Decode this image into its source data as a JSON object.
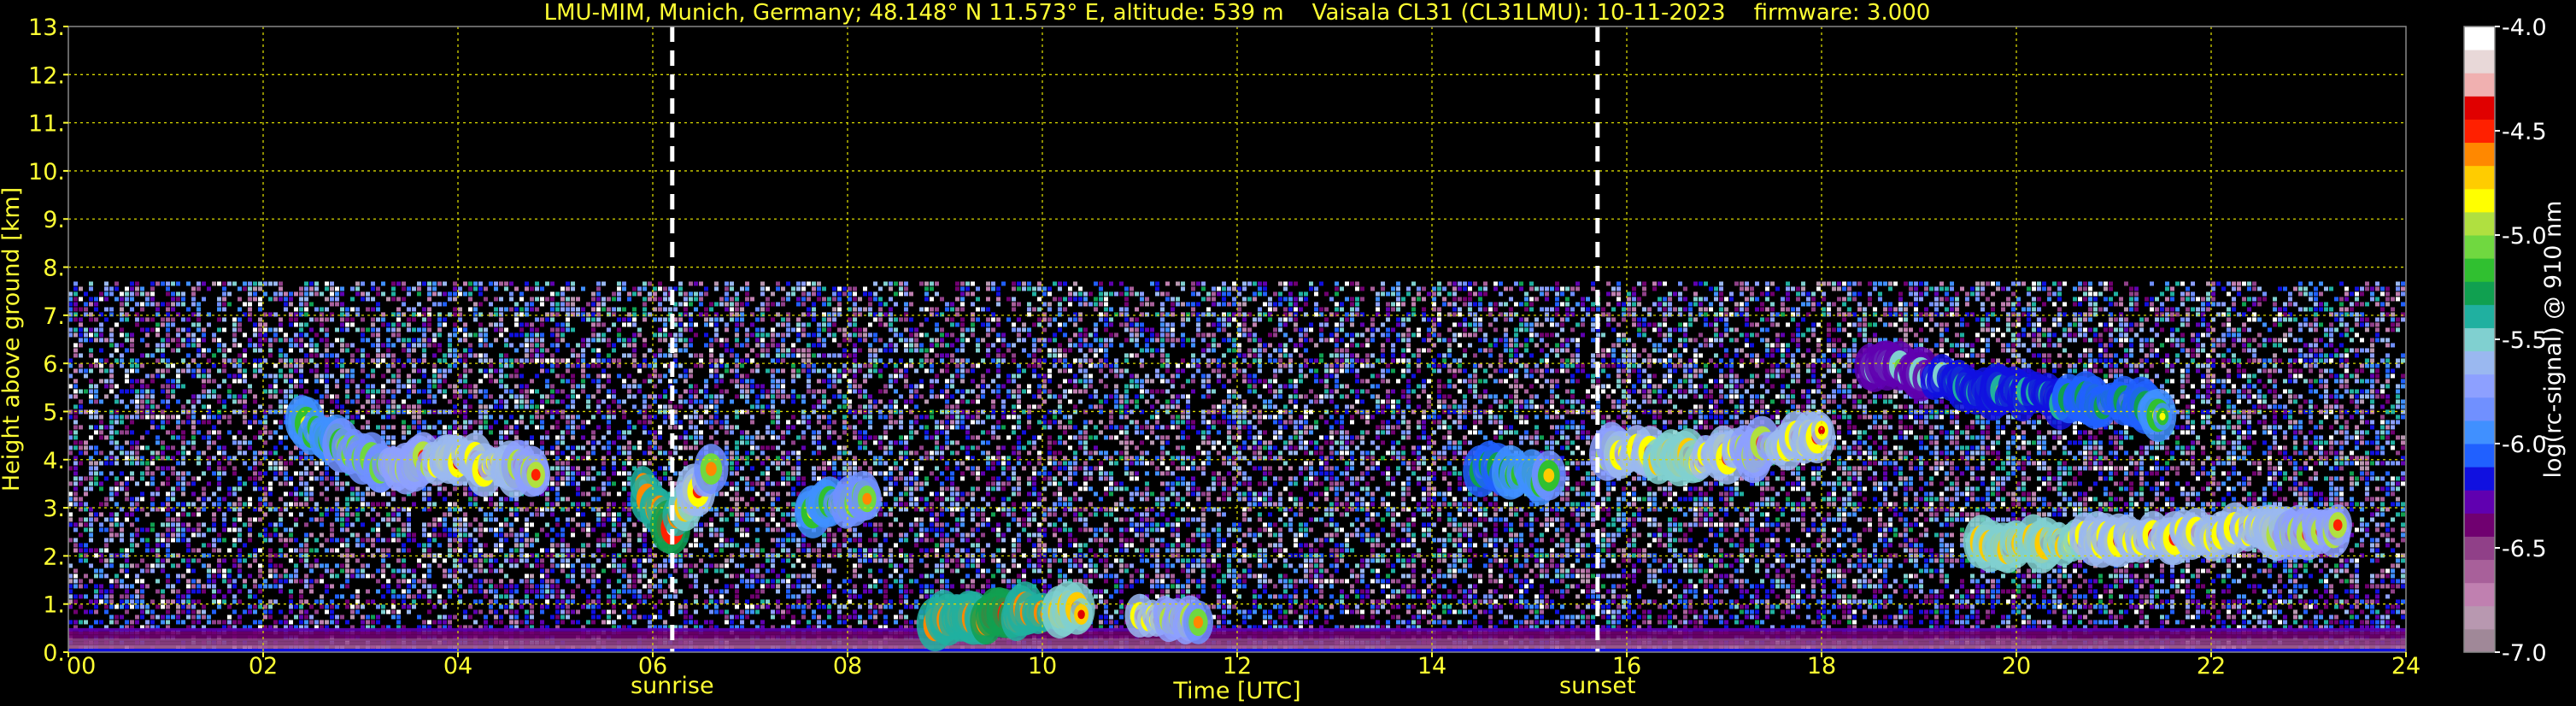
{
  "chart_data": {
    "type": "heatmap",
    "title": "LMU-MIM, Munich, Germany; 48.148° N 11.573° E, altitude: 539 m    Vaisala CL31 (CL31LMU): 10-11-2023    firmware: 3.000",
    "xlabel": "Time [UTC]",
    "ylabel": "Height above ground [km]",
    "xlim": [
      0,
      24
    ],
    "ylim": [
      0,
      13
    ],
    "x_ticks": [
      "00",
      "02",
      "04",
      "06",
      "08",
      "10",
      "12",
      "14",
      "16",
      "18",
      "20",
      "22",
      "24"
    ],
    "y_ticks": [
      "0.",
      "1.",
      "2.",
      "3.",
      "4.",
      "5.",
      "6.",
      "7.",
      "8.",
      "9.",
      "10.",
      "11.",
      "12.",
      "13."
    ],
    "grid": true,
    "events": [
      {
        "label": "sunrise",
        "x": 6.2
      },
      {
        "label": "sunset",
        "x": 15.7
      }
    ],
    "data_ceiling_km": 7.7,
    "colorbar": {
      "label": "log(rc-signal) @ 910 nm",
      "range": [
        -7.0,
        -4.0
      ],
      "ticks": [
        "-4.0",
        "-4.5",
        "-5.0",
        "-5.5",
        "-6.0",
        "-6.5",
        "-7.0"
      ],
      "tick_values": [
        -4.0,
        -4.5,
        -5.0,
        -5.5,
        -6.0,
        -6.5,
        -7.0
      ],
      "colors": [
        "#a08898",
        "#b898b0",
        "#c080b0",
        "#a8609a",
        "#904088",
        "#700070",
        "#6000b0",
        "#1010e0",
        "#2060ff",
        "#4090ff",
        "#7090ff",
        "#8da0ff",
        "#9ab8f0",
        "#80d0d0",
        "#20b0a0",
        "#10a050",
        "#30c030",
        "#70d840",
        "#b0e040",
        "#ffff00",
        "#ffcc00",
        "#ff8800",
        "#ff2000",
        "#e00000",
        "#f0b0b0",
        "#e8d8d8",
        "#ffffff"
      ]
    },
    "layers": [
      {
        "name": "surface-aerosol",
        "x": [
          0,
          24
        ],
        "height_km": [
          0,
          0.5
        ],
        "value": -6.3
      },
      {
        "name": "cloud-a",
        "points": [
          [
            2.4,
            4.7,
            -4.8
          ],
          [
            3.2,
            3.9,
            -4.6
          ],
          [
            4.0,
            4.0,
            -4.4
          ],
          [
            4.8,
            3.7,
            -4.5
          ]
        ]
      },
      {
        "name": "cloud-b",
        "points": [
          [
            5.9,
            3.4,
            -4.2
          ],
          [
            6.2,
            2.6,
            -4.1
          ],
          [
            6.6,
            3.8,
            -4.6
          ]
        ]
      },
      {
        "name": "cloud-c",
        "points": [
          [
            7.6,
            3.0,
            -4.8
          ],
          [
            8.2,
            3.2,
            -4.6
          ]
        ]
      },
      {
        "name": "low-cloud",
        "points": [
          [
            8.9,
            0.7,
            -4.2
          ],
          [
            9.6,
            0.8,
            -4.1
          ],
          [
            10.4,
            0.9,
            -4.3
          ]
        ]
      },
      {
        "name": "low-cloud-2",
        "points": [
          [
            11.0,
            0.8,
            -4.4
          ],
          [
            11.6,
            0.6,
            -4.6
          ]
        ]
      },
      {
        "name": "cloud-d",
        "points": [
          [
            14.5,
            3.8,
            -4.9
          ],
          [
            15.2,
            3.6,
            -4.7
          ]
        ]
      },
      {
        "name": "cloud-e",
        "points": [
          [
            15.8,
            4.2,
            -4.5
          ],
          [
            16.5,
            4.0,
            -4.3
          ],
          [
            17.3,
            4.2,
            -4.5
          ],
          [
            18.0,
            4.5,
            -4.4
          ]
        ]
      },
      {
        "name": "cloud-f",
        "points": [
          [
            18.5,
            6.0,
            -5.1
          ],
          [
            19.8,
            5.4,
            -5.0
          ],
          [
            20.8,
            5.2,
            -4.9
          ],
          [
            21.5,
            5.0,
            -4.8
          ]
        ]
      },
      {
        "name": "cloud-g",
        "points": [
          [
            19.6,
            2.2,
            -4.3
          ],
          [
            23.3,
            2.6,
            -4.5
          ]
        ]
      }
    ]
  }
}
